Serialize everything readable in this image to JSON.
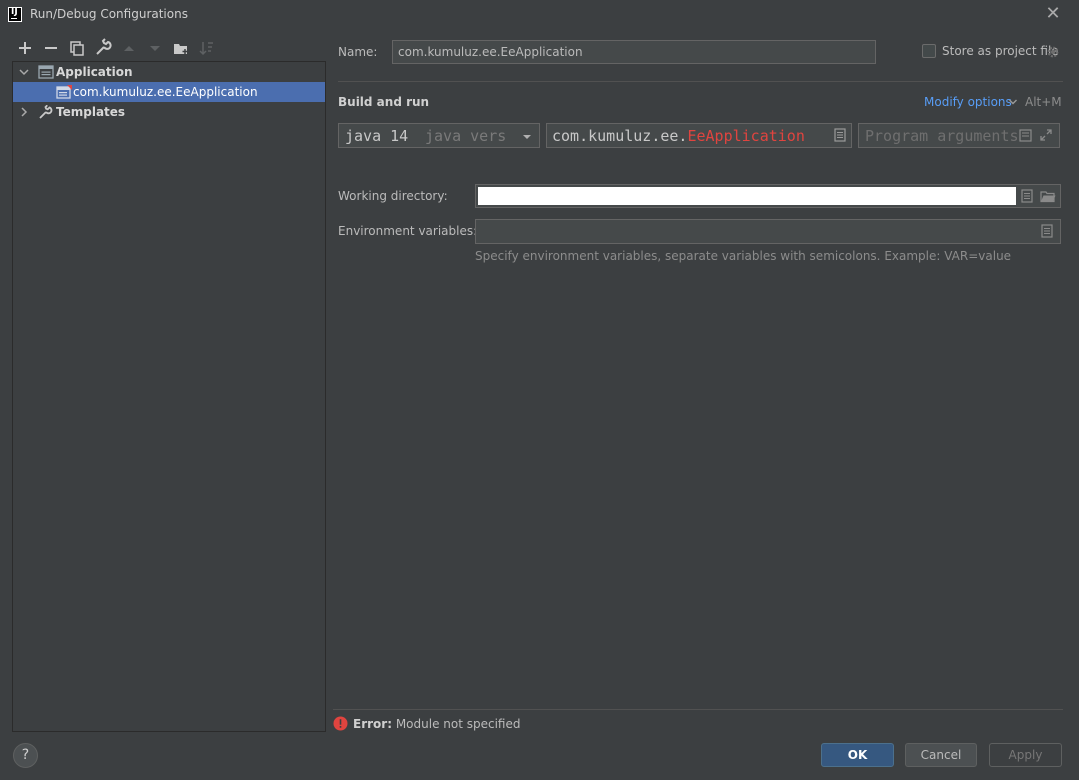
{
  "window": {
    "app_icon_text": "IJ",
    "title": "Run/Debug Configurations"
  },
  "toolbar": {
    "icons": [
      "add-icon",
      "remove-icon",
      "copy-icon",
      "wrench-icon",
      "move-up-icon",
      "move-down-icon",
      "new-folder-icon",
      "sort-icon"
    ]
  },
  "tree": {
    "application_label": "Application",
    "config_label": "com.kumuluz.ee.EeApplication",
    "templates_label": "Templates"
  },
  "form": {
    "name_label": "Name:",
    "name_value": "com.kumuluz.ee.EeApplication",
    "store_label": "Store as project file",
    "store_checked": false,
    "section_title": "Build and run",
    "modify_options": "Modify options",
    "modify_shortcut": "Alt+M",
    "jre_value": "java 14",
    "jre_hint": "java vers",
    "main_class_prefix": "com.kumuluz.ee.",
    "main_class_error": "EeApplication",
    "program_args_placeholder": "Program arguments",
    "working_dir_label": "Working directory:",
    "working_dir_value": "",
    "env_label": "Environment variables:",
    "env_value": "",
    "env_hint": "Specify environment variables, separate variables with semicolons. Example: VAR=value"
  },
  "status": {
    "error_prefix": "Error:",
    "error_message": "Module not specified"
  },
  "buttons": {
    "help": "?",
    "ok": "OK",
    "cancel": "Cancel",
    "apply": "Apply"
  },
  "colors": {
    "background": "#3c3f41",
    "selection": "#4b6eaf",
    "link": "#589df6",
    "error": "#e0443f",
    "primary_button": "#365880"
  }
}
